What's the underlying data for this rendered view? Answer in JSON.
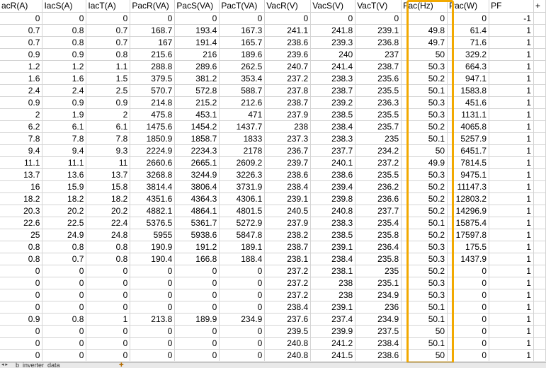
{
  "columns": [
    "acR(A)",
    "IacS(A)",
    "IacT(A)",
    "PacR(VA)",
    "PacS(VA)",
    "PacT(VA)",
    "VacR(V)",
    "VacS(V)",
    "VacT(V)",
    "Fac(Hz)",
    "Pac(W)",
    "PF",
    "+"
  ],
  "highlighted_column": "Fac(Hz)",
  "highlight_color": "#f2a900",
  "rows": [
    [
      "0",
      "0",
      "0",
      "0",
      "0",
      "0",
      "0",
      "0",
      "0",
      "0",
      "0",
      "-1",
      ""
    ],
    [
      "0.7",
      "0.8",
      "0.7",
      "168.7",
      "193.4",
      "167.3",
      "241.1",
      "241.8",
      "239.1",
      "49.8",
      "61.4",
      "1",
      ""
    ],
    [
      "0.7",
      "0.8",
      "0.7",
      "167",
      "191.4",
      "165.7",
      "238.6",
      "239.3",
      "236.8",
      "49.7",
      "71.6",
      "1",
      ""
    ],
    [
      "0.9",
      "0.9",
      "0.8",
      "215.6",
      "216",
      "189.6",
      "239.6",
      "240",
      "237",
      "50",
      "329.2",
      "1",
      ""
    ],
    [
      "1.2",
      "1.2",
      "1.1",
      "288.8",
      "289.6",
      "262.5",
      "240.7",
      "241.4",
      "238.7",
      "50.3",
      "664.3",
      "1",
      ""
    ],
    [
      "1.6",
      "1.6",
      "1.5",
      "379.5",
      "381.2",
      "353.4",
      "237.2",
      "238.3",
      "235.6",
      "50.2",
      "947.1",
      "1",
      ""
    ],
    [
      "2.4",
      "2.4",
      "2.5",
      "570.7",
      "572.8",
      "588.7",
      "237.8",
      "238.7",
      "235.5",
      "50.1",
      "1583.8",
      "1",
      ""
    ],
    [
      "0.9",
      "0.9",
      "0.9",
      "214.8",
      "215.2",
      "212.6",
      "238.7",
      "239.2",
      "236.3",
      "50.3",
      "451.6",
      "1",
      ""
    ],
    [
      "2",
      "1.9",
      "2",
      "475.8",
      "453.1",
      "471",
      "237.9",
      "238.5",
      "235.5",
      "50.3",
      "1131.1",
      "1",
      ""
    ],
    [
      "6.2",
      "6.1",
      "6.1",
      "1475.6",
      "1454.2",
      "1437.7",
      "238",
      "238.4",
      "235.7",
      "50.2",
      "4065.8",
      "1",
      ""
    ],
    [
      "7.8",
      "7.8",
      "7.8",
      "1850.9",
      "1858.7",
      "1833",
      "237.3",
      "238.3",
      "235",
      "50.1",
      "5257.9",
      "1",
      ""
    ],
    [
      "9.4",
      "9.4",
      "9.3",
      "2224.9",
      "2234.3",
      "2178",
      "236.7",
      "237.7",
      "234.2",
      "50",
      "6451.7",
      "1",
      ""
    ],
    [
      "11.1",
      "11.1",
      "11",
      "2660.6",
      "2665.1",
      "2609.2",
      "239.7",
      "240.1",
      "237.2",
      "49.9",
      "7814.5",
      "1",
      ""
    ],
    [
      "13.7",
      "13.6",
      "13.7",
      "3268.8",
      "3244.9",
      "3226.3",
      "238.6",
      "238.6",
      "235.5",
      "50.3",
      "9475.1",
      "1",
      ""
    ],
    [
      "16",
      "15.9",
      "15.8",
      "3814.4",
      "3806.4",
      "3731.9",
      "238.4",
      "239.4",
      "236.2",
      "50.2",
      "11147.3",
      "1",
      ""
    ],
    [
      "18.2",
      "18.2",
      "18.2",
      "4351.6",
      "4364.3",
      "4306.1",
      "239.1",
      "239.8",
      "236.6",
      "50.2",
      "12803.2",
      "1",
      ""
    ],
    [
      "20.3",
      "20.2",
      "20.2",
      "4882.1",
      "4864.1",
      "4801.5",
      "240.5",
      "240.8",
      "237.7",
      "50.2",
      "14296.9",
      "1",
      ""
    ],
    [
      "22.6",
      "22.5",
      "22.4",
      "5376.5",
      "5361.7",
      "5272.9",
      "237.9",
      "238.3",
      "235.4",
      "50.1",
      "15875.4",
      "1",
      ""
    ],
    [
      "25",
      "24.9",
      "24.8",
      "5955",
      "5938.6",
      "5847.8",
      "238.2",
      "238.5",
      "235.8",
      "50.2",
      "17597.8",
      "1",
      ""
    ],
    [
      "0.8",
      "0.8",
      "0.8",
      "190.9",
      "191.2",
      "189.1",
      "238.7",
      "239.1",
      "236.4",
      "50.3",
      "175.5",
      "1",
      ""
    ],
    [
      "0.8",
      "0.7",
      "0.8",
      "190.4",
      "166.8",
      "188.4",
      "238.1",
      "238.4",
      "235.8",
      "50.3",
      "1437.9",
      "1",
      ""
    ],
    [
      "0",
      "0",
      "0",
      "0",
      "0",
      "0",
      "237.2",
      "238.1",
      "235",
      "50.2",
      "0",
      "1",
      ""
    ],
    [
      "0",
      "0",
      "0",
      "0",
      "0",
      "0",
      "237.2",
      "238",
      "235.1",
      "50.3",
      "0",
      "1",
      ""
    ],
    [
      "0",
      "0",
      "0",
      "0",
      "0",
      "0",
      "237.2",
      "238",
      "234.9",
      "50.3",
      "0",
      "1",
      ""
    ],
    [
      "0",
      "0",
      "0",
      "0",
      "0",
      "0",
      "238.4",
      "239.1",
      "236",
      "50.1",
      "0",
      "1",
      ""
    ],
    [
      "0.9",
      "0.8",
      "1",
      "213.8",
      "189.9",
      "234.9",
      "237.6",
      "237.4",
      "234.9",
      "50.1",
      "0",
      "1",
      ""
    ],
    [
      "0",
      "0",
      "0",
      "0",
      "0",
      "0",
      "239.5",
      "239.9",
      "237.5",
      "50",
      "0",
      "1",
      ""
    ],
    [
      "0",
      "0",
      "0",
      "0",
      "0",
      "0",
      "240.8",
      "241.2",
      "238.4",
      "50.1",
      "0",
      "1",
      ""
    ],
    [
      "0",
      "0",
      "0",
      "0",
      "0",
      "0",
      "240.8",
      "241.5",
      "238.6",
      "50",
      "0",
      "1",
      ""
    ]
  ],
  "sheet_tab": {
    "nav_symbol": "◂ ▸",
    "label": "b_inverter_data",
    "add_symbol": "✚"
  }
}
